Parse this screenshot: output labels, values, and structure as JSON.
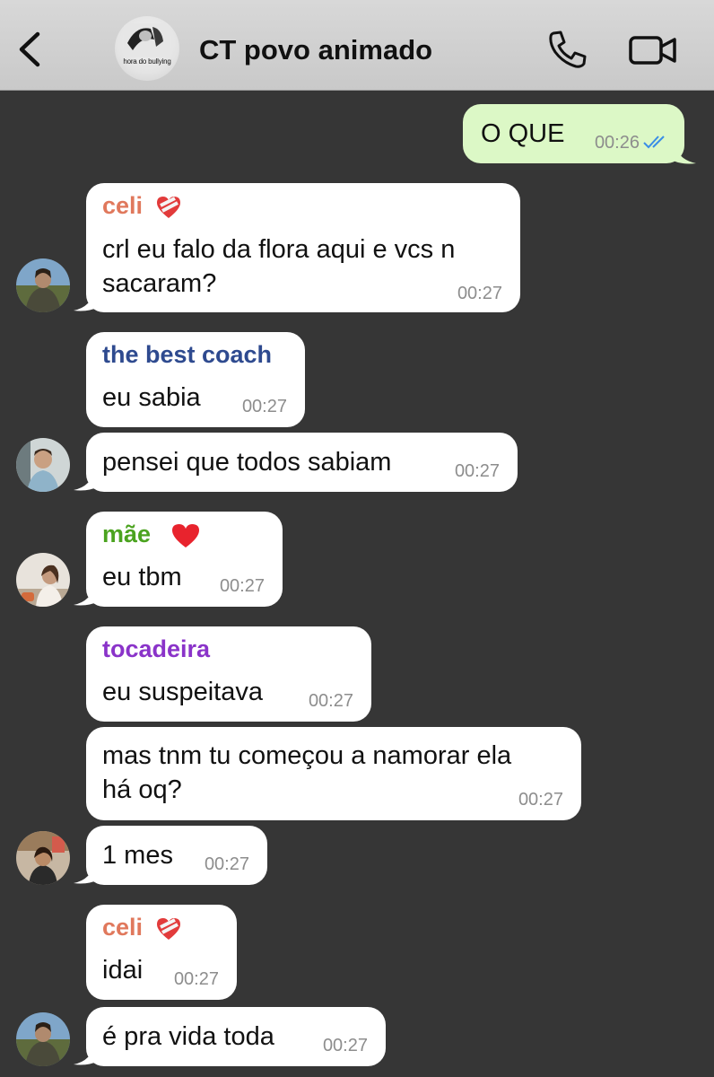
{
  "header": {
    "title": "CT povo animado",
    "avatar_caption": "hora do bullying"
  },
  "messages": {
    "m1": {
      "text": "O QUE",
      "time": "00:26"
    },
    "m2": {
      "sender": "celi",
      "line1": "crl eu falo da flora aqui e vcs n",
      "line2": "sacaram?",
      "time": "00:27"
    },
    "m3": {
      "sender": "the best coach",
      "text": "eu sabia",
      "time": "00:27"
    },
    "m4": {
      "text": "pensei que todos sabiam",
      "time": "00:27"
    },
    "m5": {
      "sender": "mãe",
      "text": "eu tbm",
      "time": "00:27"
    },
    "m6": {
      "sender": "tocadeira",
      "text": "eu suspeitava",
      "time": "00:27"
    },
    "m7": {
      "line1": "mas tnm tu começou a namorar ela",
      "line2": "há oq?",
      "time": "00:27"
    },
    "m8": {
      "text": "1 mes",
      "time": "00:27"
    },
    "m9": {
      "sender": "celi",
      "text": "idai",
      "time": "00:27"
    },
    "m10": {
      "text": "é pra vida toda",
      "time": "00:27"
    }
  },
  "colors": {
    "chat_background": "#363636",
    "outgoing_bubble": "#dcf8c6",
    "incoming_bubble": "#ffffff",
    "celi": "#e0785c",
    "the_best_coach": "#2e4a8f",
    "mae": "#4ba31f",
    "tocadeira": "#8a33c9",
    "read_ticks": "#3a8ee6"
  },
  "icons": [
    "back-chevron-icon",
    "phone-icon",
    "video-camera-icon",
    "double-check-icon",
    "heart-icon"
  ]
}
